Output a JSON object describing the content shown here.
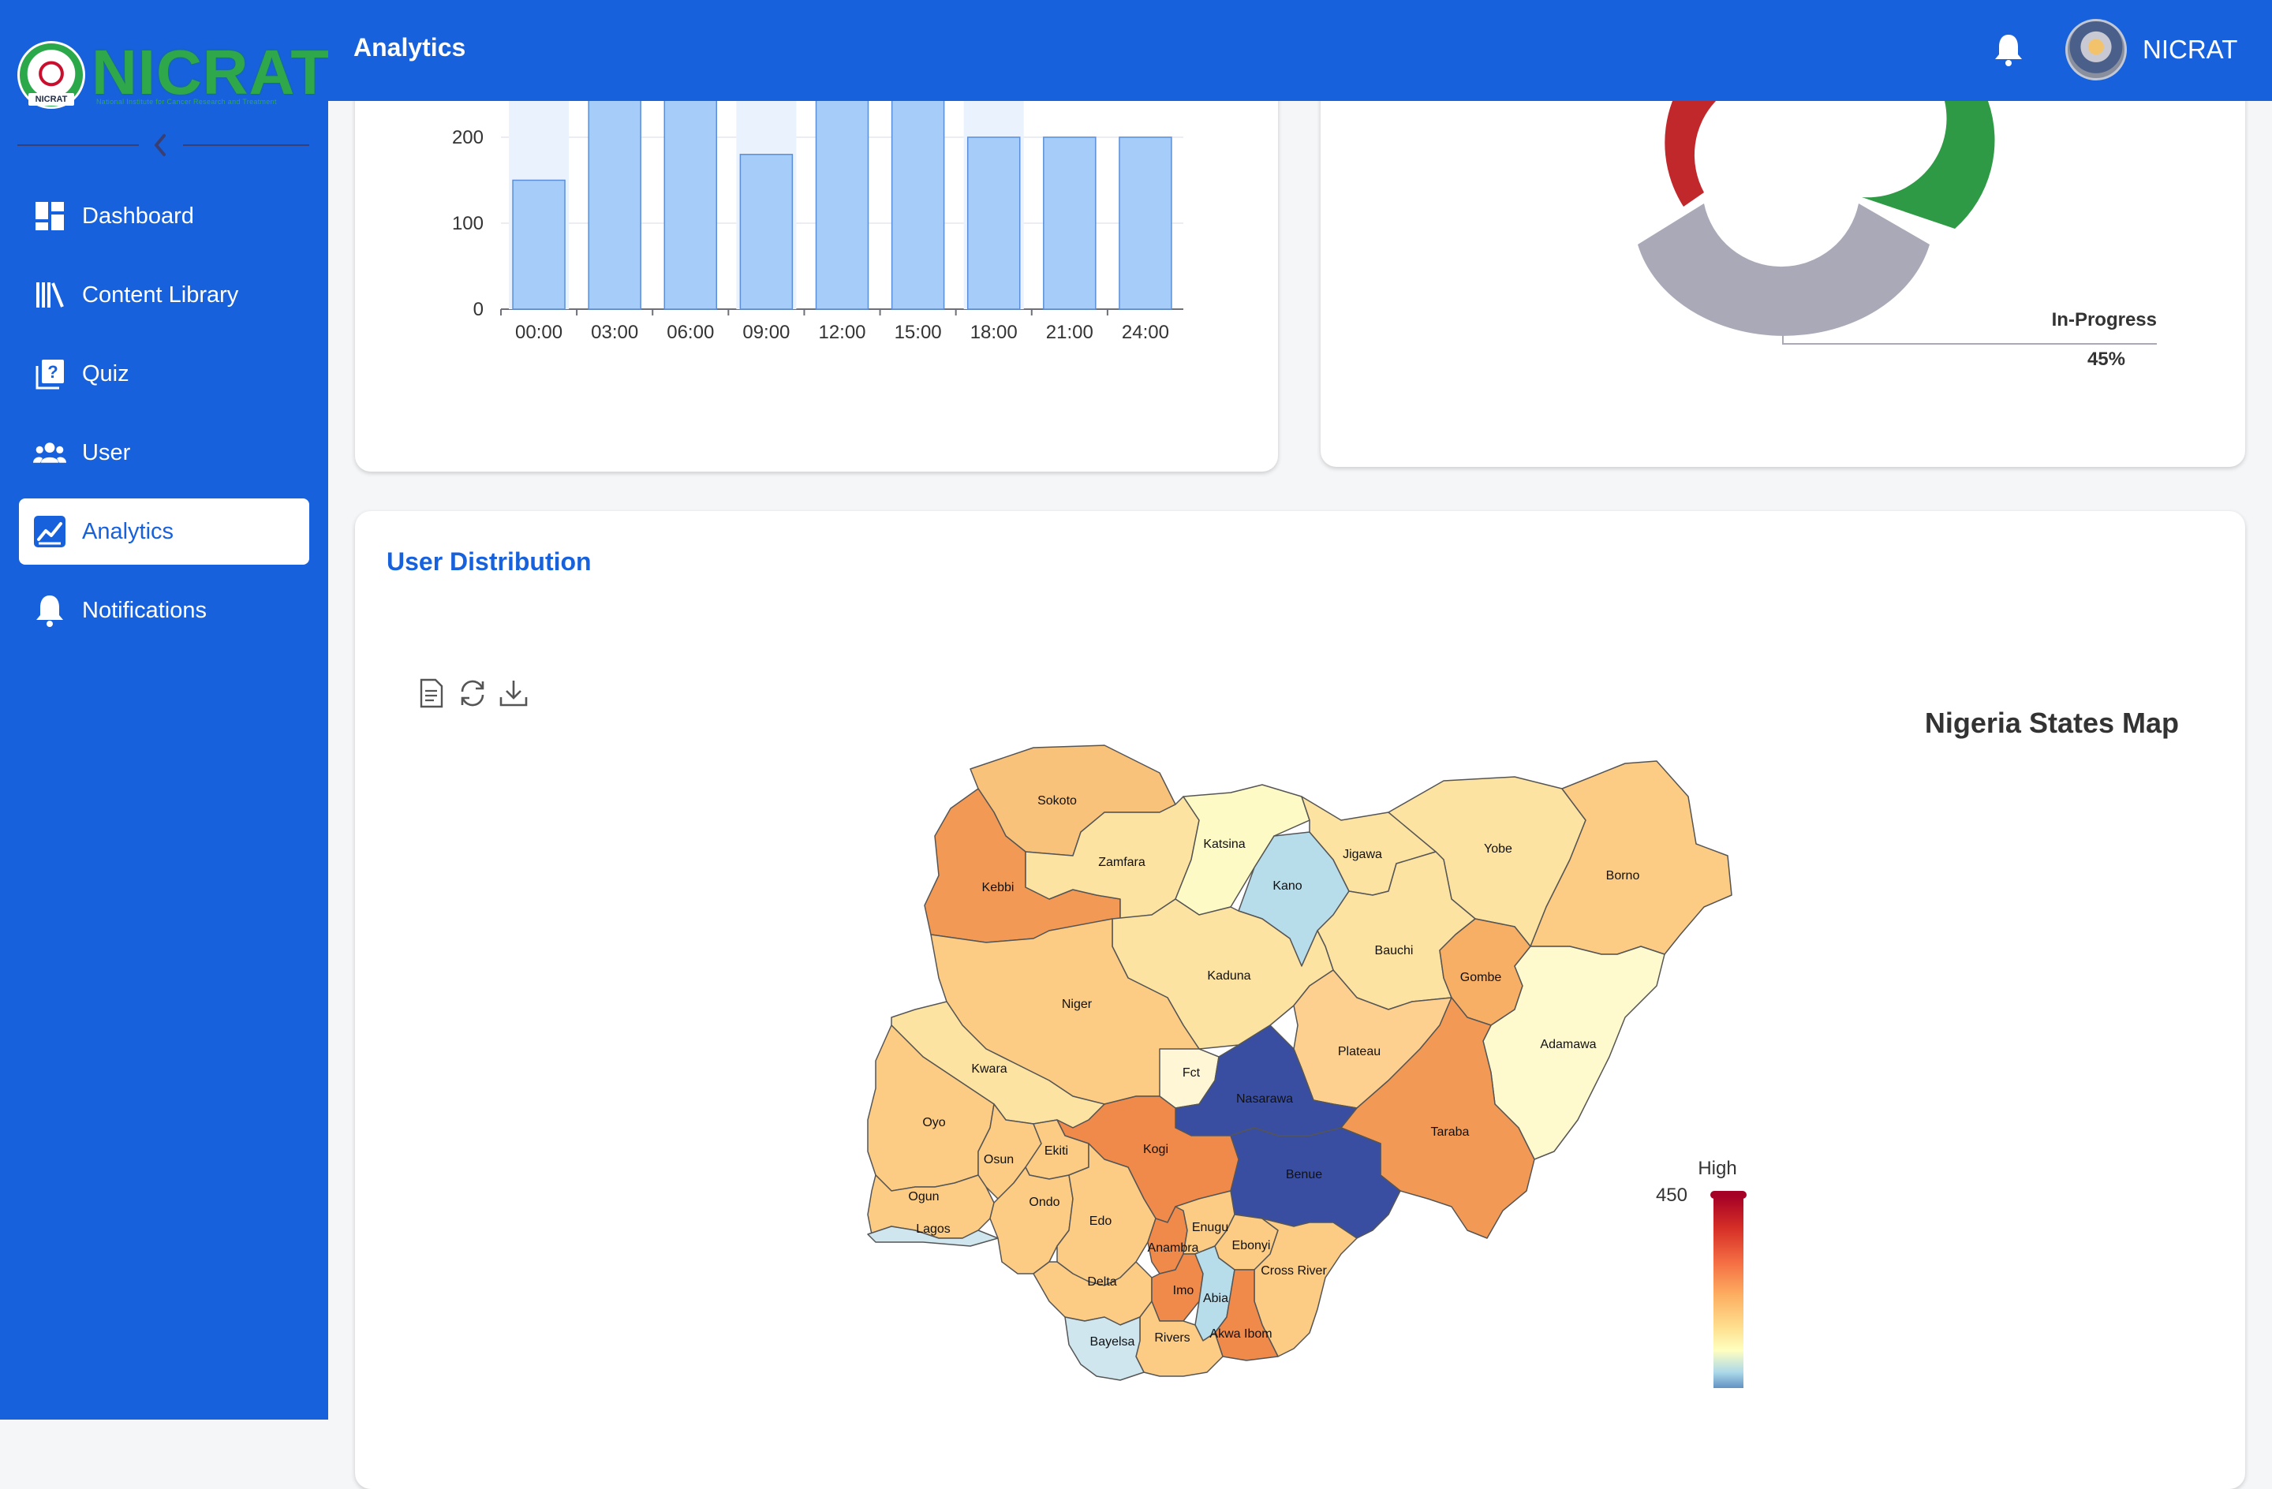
{
  "sidebar": {
    "logo_text": "NICRAT",
    "logo_tagline": "National Institute for Cancer Research and Treatment",
    "logo_badge": "NICRAT",
    "items": [
      {
        "label": "Dashboard",
        "icon": "dashboard-icon"
      },
      {
        "label": "Content Library",
        "icon": "library-icon"
      },
      {
        "label": "Quiz",
        "icon": "quiz-icon"
      },
      {
        "label": "User",
        "icon": "users-icon"
      },
      {
        "label": "Analytics",
        "icon": "analytics-icon",
        "active": true
      },
      {
        "label": "Notifications",
        "icon": "bell-icon"
      }
    ]
  },
  "header": {
    "title": "Analytics",
    "user_name": "NICRAT"
  },
  "colors": {
    "brand_blue": "#1761dd",
    "bar_fill": "#a6cdfa",
    "donut_red": "#c0282c",
    "donut_green": "#2f9a45",
    "donut_grey": "#a9a9b8"
  },
  "bar_chart": {
    "chart_data": {
      "type": "bar",
      "categories": [
        "00:00",
        "03:00",
        "06:00",
        "09:00",
        "12:00",
        "15:00",
        "18:00",
        "21:00",
        "24:00"
      ],
      "values": [
        150,
        260,
        260,
        180,
        260,
        260,
        200,
        200,
        200
      ],
      "y_ticks": [
        "0",
        "100",
        "200"
      ],
      "ylim": [
        0,
        250
      ],
      "grid": true
    }
  },
  "donut_chart": {
    "chart_data": {
      "type": "pie",
      "labels": [
        "In-Progress"
      ],
      "values": [
        45
      ],
      "label_text": "In-Progress",
      "percent_text": "45%"
    }
  },
  "map_section": {
    "title": "User Distribution",
    "map_title": "Nigeria States Map",
    "toolbox": [
      "data-view-icon",
      "refresh-icon",
      "download-icon"
    ],
    "legend": {
      "high_label": "High",
      "max": "450",
      "min": "200"
    },
    "states": [
      "Sokoto",
      "Zamfara",
      "Katsina",
      "Kano",
      "Jigawa",
      "Yobe",
      "Borno",
      "Kebbi",
      "Bauchi",
      "Gombe",
      "Kaduna",
      "Niger",
      "Adamawa",
      "Plateau",
      "Fct",
      "Kwara",
      "Nasarawa",
      "Oyo",
      "Taraba",
      "Kogi",
      "Ekiti",
      "Osun",
      "Benue",
      "Ogun",
      "Ondo",
      "Edo",
      "Enugu",
      "Ebonyi",
      "Lagos",
      "Anambra",
      "Cross River",
      "Delta",
      "Imo",
      "Abia",
      "Bayelsa",
      "Rivers",
      "Akwa Ibom"
    ]
  }
}
